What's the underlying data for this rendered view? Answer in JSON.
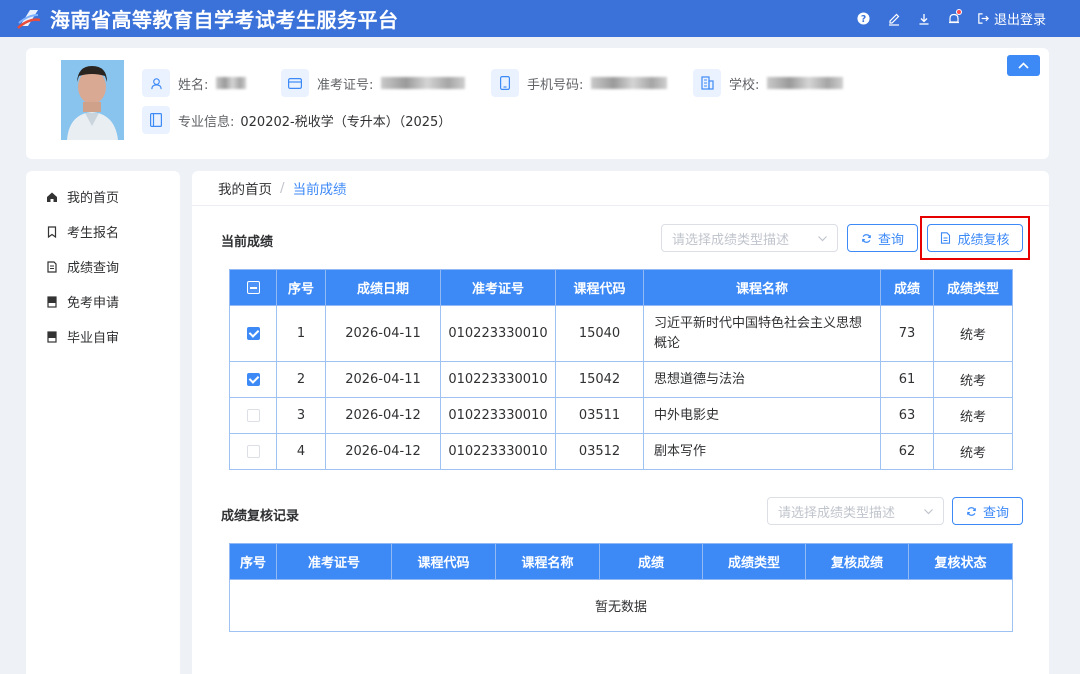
{
  "header": {
    "title": "海南省高等教育自学考试考生服务平台",
    "logout_label": "退出登录",
    "icons": [
      "help-icon",
      "edit-icon",
      "download-icon",
      "bell-icon",
      "logout-icon"
    ]
  },
  "profile": {
    "name_label": "姓名:",
    "exam_id_label": "准考证号:",
    "phone_label": "手机号码:",
    "school_label": "学校:",
    "major_label": "专业信息:",
    "major_value": "020202-税收学（专升本）（2025）"
  },
  "sidebar": {
    "items": [
      {
        "label": "我的首页",
        "icon": "home-icon"
      },
      {
        "label": "考生报名",
        "icon": "bookmark-icon"
      },
      {
        "label": "成绩查询",
        "icon": "document-icon"
      },
      {
        "label": "免考申请",
        "icon": "book-icon"
      },
      {
        "label": "毕业自审",
        "icon": "book-icon"
      }
    ]
  },
  "breadcrumb": {
    "home": "我的首页",
    "separator": "/",
    "current": "当前成绩"
  },
  "current_scores": {
    "title": "当前成绩",
    "select_placeholder": "请选择成绩类型描述",
    "query_label": "查询",
    "review_label": "成绩复核",
    "columns": [
      "序号",
      "成绩日期",
      "准考证号",
      "课程代码",
      "课程名称",
      "成绩",
      "成绩类型"
    ],
    "rows": [
      {
        "checked": true,
        "no": "1",
        "date": "2026-04-11",
        "exam_id": "010223330010",
        "code": "15040",
        "name": "习近平新时代中国特色社会主义思想概论",
        "score": "73",
        "type": "统考"
      },
      {
        "checked": true,
        "no": "2",
        "date": "2026-04-11",
        "exam_id": "010223330010",
        "code": "15042",
        "name": "思想道德与法治",
        "score": "61",
        "type": "统考"
      },
      {
        "checked": false,
        "no": "3",
        "date": "2026-04-12",
        "exam_id": "010223330010",
        "code": "03511",
        "name": "中外电影史",
        "score": "63",
        "type": "统考"
      },
      {
        "checked": false,
        "no": "4",
        "date": "2026-04-12",
        "exam_id": "010223330010",
        "code": "03512",
        "name": "剧本写作",
        "score": "62",
        "type": "统考"
      }
    ]
  },
  "review_records": {
    "title": "成绩复核记录",
    "select_placeholder": "请选择成绩类型描述",
    "query_label": "查询",
    "columns": [
      "序号",
      "准考证号",
      "课程代码",
      "课程名称",
      "成绩",
      "成绩类型",
      "复核成绩",
      "复核状态"
    ],
    "empty_text": "暂无数据"
  },
  "colors": {
    "primary": "#3b72d9",
    "accent": "#3d8af7",
    "highlight": "#e60000"
  }
}
